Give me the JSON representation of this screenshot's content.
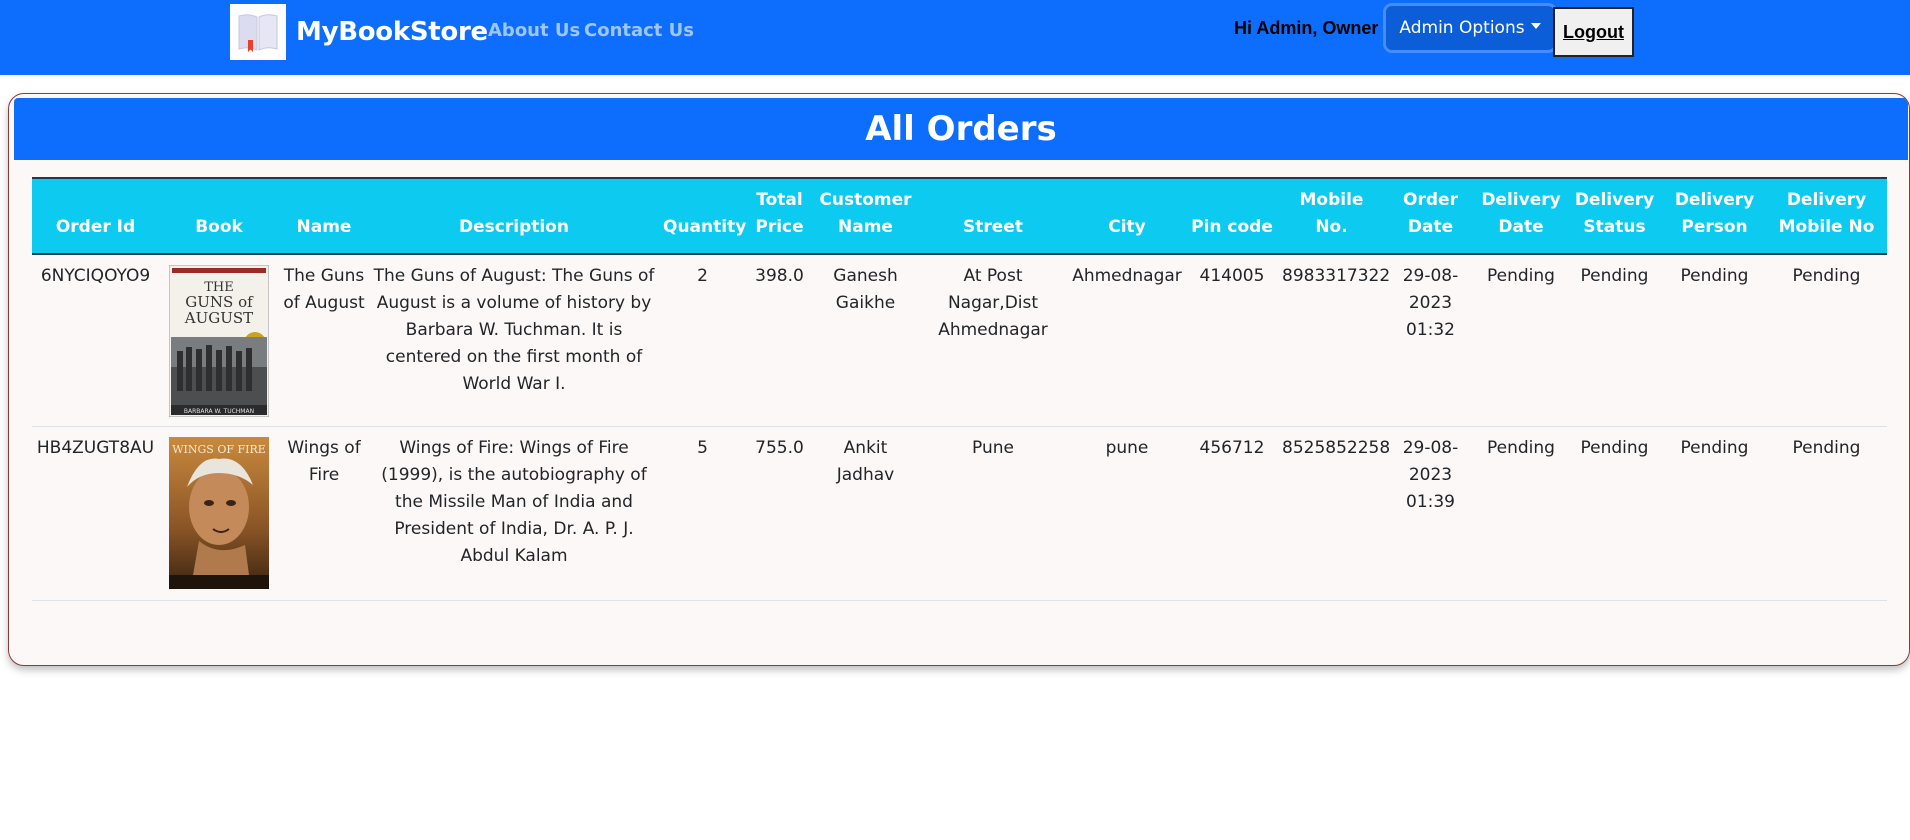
{
  "navbar": {
    "brand": "MyBookStore",
    "links": [
      "About Us",
      "Contact Us"
    ],
    "greeting": "Hi Admin, Owner",
    "admin_options": "Admin Options",
    "logout": "Logout",
    "colors": {
      "navbar": "#0d6efd",
      "admin_button": "#0b5ed7"
    }
  },
  "page": {
    "title": "All Orders",
    "header_color": "#0d6efd",
    "table_header_color": "#0dcaf0"
  },
  "table": {
    "headers": [
      "Order Id",
      "Book",
      "Name",
      "Description",
      "Quantity",
      "Total Price",
      "Customer Name",
      "Street",
      "City",
      "Pin code",
      "Mobile No.",
      "Order Date",
      "Delivery Date",
      "Delivery Status",
      "Delivery Person",
      "Delivery Mobile No"
    ],
    "rows": [
      {
        "order_id": "6NYCIQOYO9",
        "cover": {
          "icon": "book-cover-guns-of-august",
          "lines": [
            "THE",
            "GUNS of",
            "AUGUST"
          ],
          "author": "BARBARA W. TUCHMAN"
        },
        "name": "The Guns of August",
        "description": "The Guns of August: The Guns of August is a volume of history by Barbara W. Tuchman. It is centered on the first month of World War I.",
        "quantity": "2",
        "total_price": "398.0",
        "customer_name": "Ganesh Gaikhe",
        "street": "At Post Nagar,Dist Ahmednagar",
        "city": "Ahmednagar",
        "pin_code": "414005",
        "mobile": "8983317322",
        "order_date": "29-08-2023 01:32",
        "delivery_date": "Pending",
        "delivery_status": "Pending",
        "delivery_person": "Pending",
        "delivery_mobile": "Pending"
      },
      {
        "order_id": "HB4ZUGT8AU",
        "cover": {
          "icon": "book-cover-wings-of-fire",
          "lines": [
            "WINGS OF FIRE"
          ]
        },
        "name": "Wings of Fire",
        "description": "Wings of Fire: Wings of Fire (1999), is the autobiography of the Missile Man of India and President of India, Dr. A. P. J. Abdul Kalam",
        "quantity": "5",
        "total_price": "755.0",
        "customer_name": "Ankit Jadhav",
        "street": "Pune",
        "city": "pune",
        "pin_code": "456712",
        "mobile": "8525852258",
        "order_date": "29-08-2023 01:39",
        "delivery_date": "Pending",
        "delivery_status": "Pending",
        "delivery_person": "Pending",
        "delivery_mobile": "Pending"
      }
    ]
  }
}
